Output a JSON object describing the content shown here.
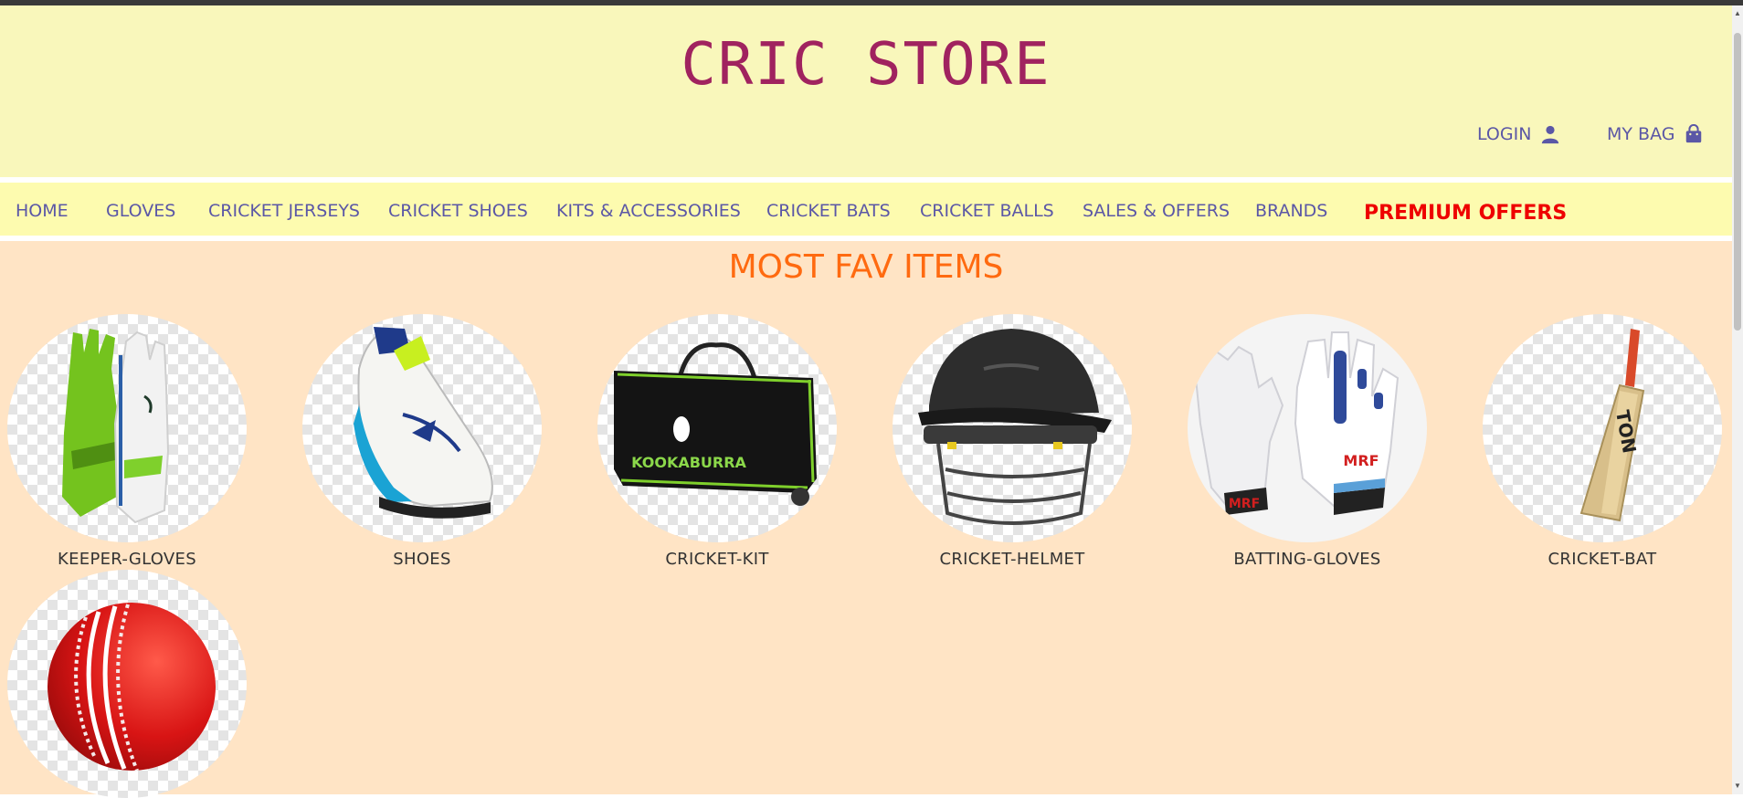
{
  "site": {
    "title": "CRIC STORE"
  },
  "account": {
    "login_label": "LOGIN",
    "bag_label": "MY BAG"
  },
  "nav": {
    "items": [
      "HOME",
      "GLOVES",
      "CRICKET JERSEYS",
      "CRICKET SHOES",
      "KITS & ACCESSORIES",
      "CRICKET BATS",
      "CRICKET BALLS",
      "SALES & OFFERS",
      "BRANDS"
    ],
    "premium_label": "PREMIUM OFFERS"
  },
  "fav": {
    "title": "MOST FAV ITEMS",
    "items": [
      {
        "label": "KEEPER-GLOVES",
        "icon": "keeper-gloves-image"
      },
      {
        "label": "SHOES",
        "icon": "shoe-image"
      },
      {
        "label": "CRICKET-KIT",
        "icon": "kit-bag-image",
        "brand_text": "KOOKABURRA"
      },
      {
        "label": "CRICKET-HELMET",
        "icon": "helmet-image"
      },
      {
        "label": "BATTING-GLOVES",
        "icon": "batting-gloves-image",
        "brand_text": "MRF"
      },
      {
        "label": "CRICKET-BAT",
        "icon": "bat-image",
        "brand_text": "TON"
      },
      {
        "label": "",
        "icon": "ball-image"
      }
    ]
  },
  "colors": {
    "header_bg": "#f9f7bb",
    "nav_bg": "#fdfbaf",
    "section_bg": "#ffe4c5",
    "title_color": "#a0235f",
    "link_color": "#5b57a6",
    "premium_color": "#ee0000",
    "section_title_color": "#ff6a10"
  }
}
